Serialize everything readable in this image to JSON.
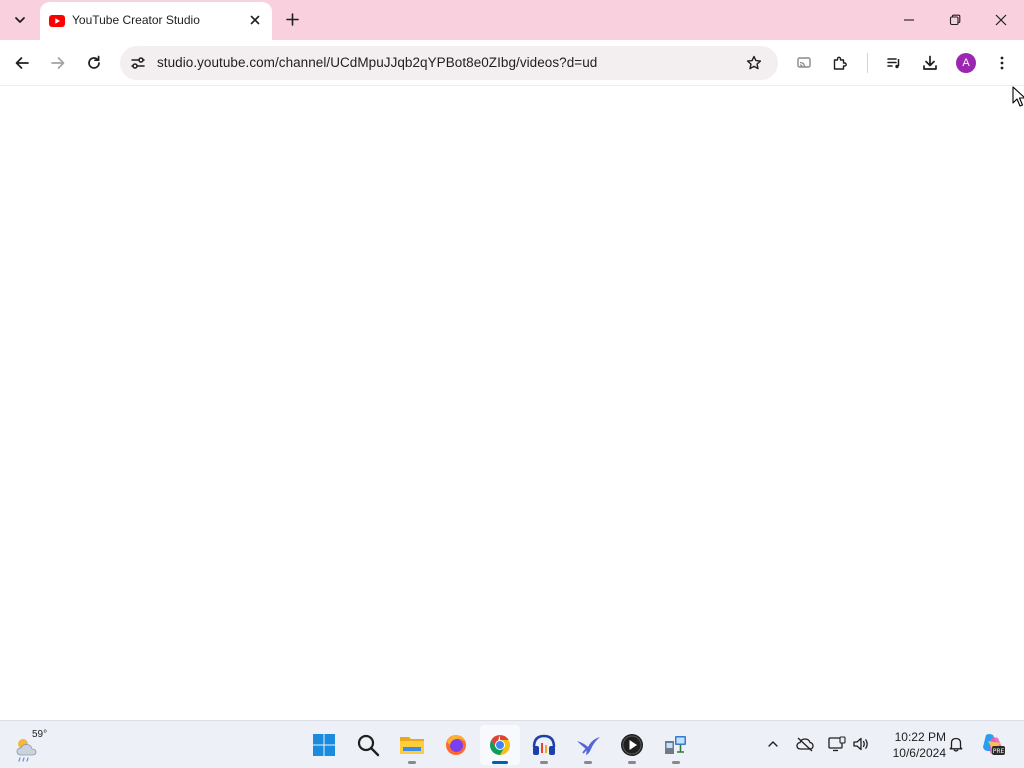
{
  "browser": {
    "tab": {
      "title": "YouTube Creator Studio",
      "favicon": "youtube-icon"
    },
    "url": "studio.youtube.com/channel/UCdMpuJJqb2qYPBot8e0ZIbg/videos?d=ud",
    "profile_initial": "A",
    "icons": {
      "tab_search": "chevron-down-icon",
      "new_tab": "plus-icon",
      "minimize": "minimize-icon",
      "restore": "restore-icon",
      "close": "close-icon",
      "back": "back-arrow-icon",
      "forward": "forward-arrow-icon",
      "reload": "reload-icon",
      "site_info": "tune-icon",
      "bookmark": "star-icon",
      "cast": "cast-icon",
      "extensions": "puzzle-icon",
      "media": "media-control-icon",
      "downloads": "download-icon",
      "menu": "kebab-menu-icon"
    }
  },
  "taskbar": {
    "weather_temp": "59°",
    "time": "10:22 PM",
    "date": "10/6/2024",
    "apps": [
      "windows-start-icon",
      "search-icon",
      "file-explorer-icon",
      "firefox-icon",
      "chrome-icon",
      "audio-app-icon",
      "bird-app-icon",
      "media-player-icon",
      "network-app-icon"
    ],
    "tray": [
      "chevron-up-icon",
      "cloud-offline-icon",
      "display-icon",
      "volume-icon",
      "bell-icon",
      "copilot-icon"
    ]
  },
  "colors": {
    "tabstrip_bg": "#f9d0dd",
    "omnibox_bg": "#f3eef0",
    "avatar_bg": "#9b27b0",
    "youtube_red": "#ff0000",
    "accent_blue": "#005fb8"
  }
}
